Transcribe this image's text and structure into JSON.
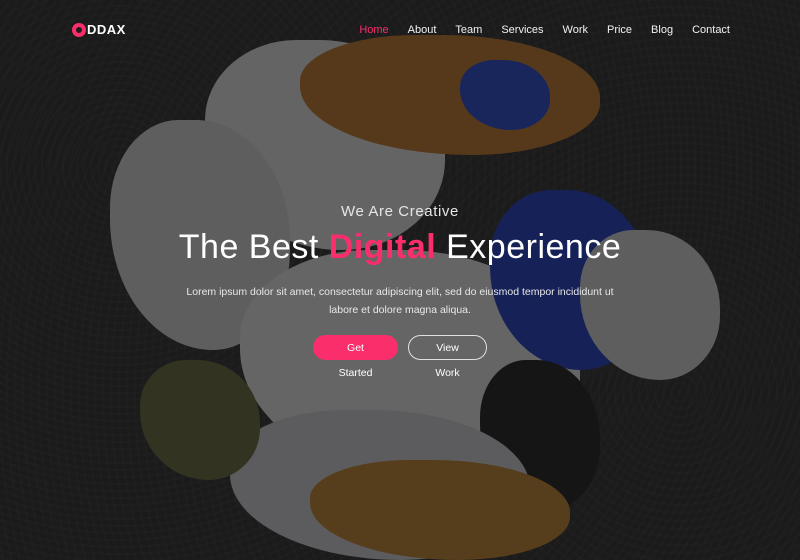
{
  "brand": {
    "logo_text": "DDAX",
    "accent": "#fb2e6c"
  },
  "nav": {
    "items": [
      {
        "label": "Home",
        "active": true
      },
      {
        "label": "About"
      },
      {
        "label": "Team"
      },
      {
        "label": "Services"
      },
      {
        "label": "Work"
      },
      {
        "label": "Price"
      },
      {
        "label": "Blog"
      },
      {
        "label": "Contact"
      }
    ]
  },
  "hero": {
    "eyebrow": "We Are Creative",
    "headline_pre": "The Best ",
    "headline_accent": "Digital",
    "headline_post": " Experience",
    "description": "Lorem ipsum dolor sit amet, consectetur adipiscing elit, sed do eiusmod tempor incididunt ut labore et dolore magna aliqua.",
    "primary_button": "Get Started",
    "secondary_button": "View Work"
  },
  "colors": {
    "background": "#2b2b2b",
    "overlay": "rgba(18,18,18,0.62)",
    "text": "#ffffff"
  }
}
